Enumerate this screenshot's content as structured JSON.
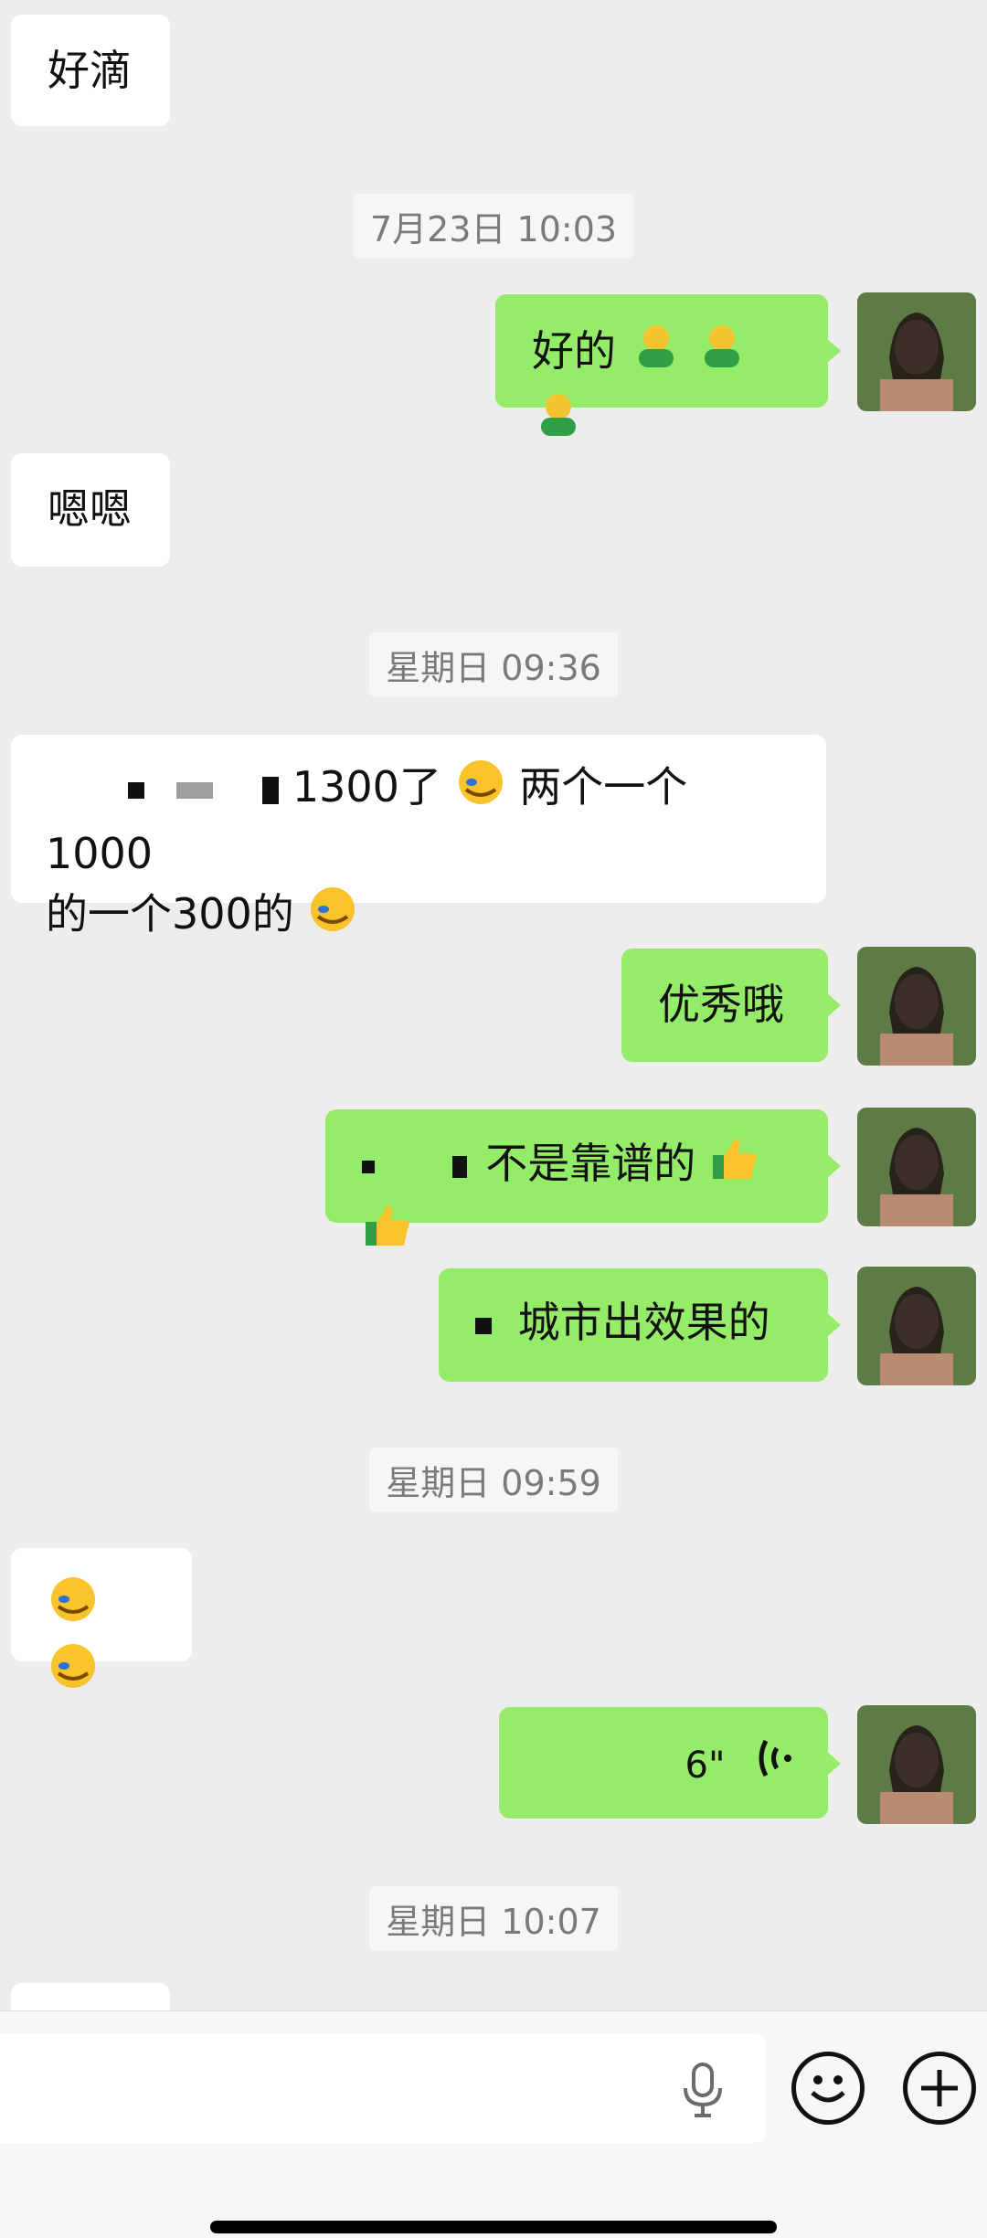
{
  "messages": {
    "m1": "好滴",
    "ts1": "7月23日 10:03",
    "m2": "好的",
    "m3": "嗯嗯",
    "ts2": "星期日 09:36",
    "m4_line1": "1300了",
    "m4_line1b": "两个一个1000",
    "m4_line2a": "的一个300的",
    "m5": "优秀哦",
    "m6": "不是靠谱的",
    "m7": "城市出效果的",
    "ts3": "星期日 09:59",
    "ts4": "星期日 10:07",
    "voice_duration": "6\""
  },
  "icons": {
    "m2_emoji": "hugging-person-emoji",
    "m4_emoji": "facepalm-laugh-emoji",
    "m6_emoji": "thumbs-up-emoji",
    "voice": "voice-wave-icon",
    "mic": "mic-icon",
    "smile": "smile-icon",
    "plus": "plus-icon"
  }
}
